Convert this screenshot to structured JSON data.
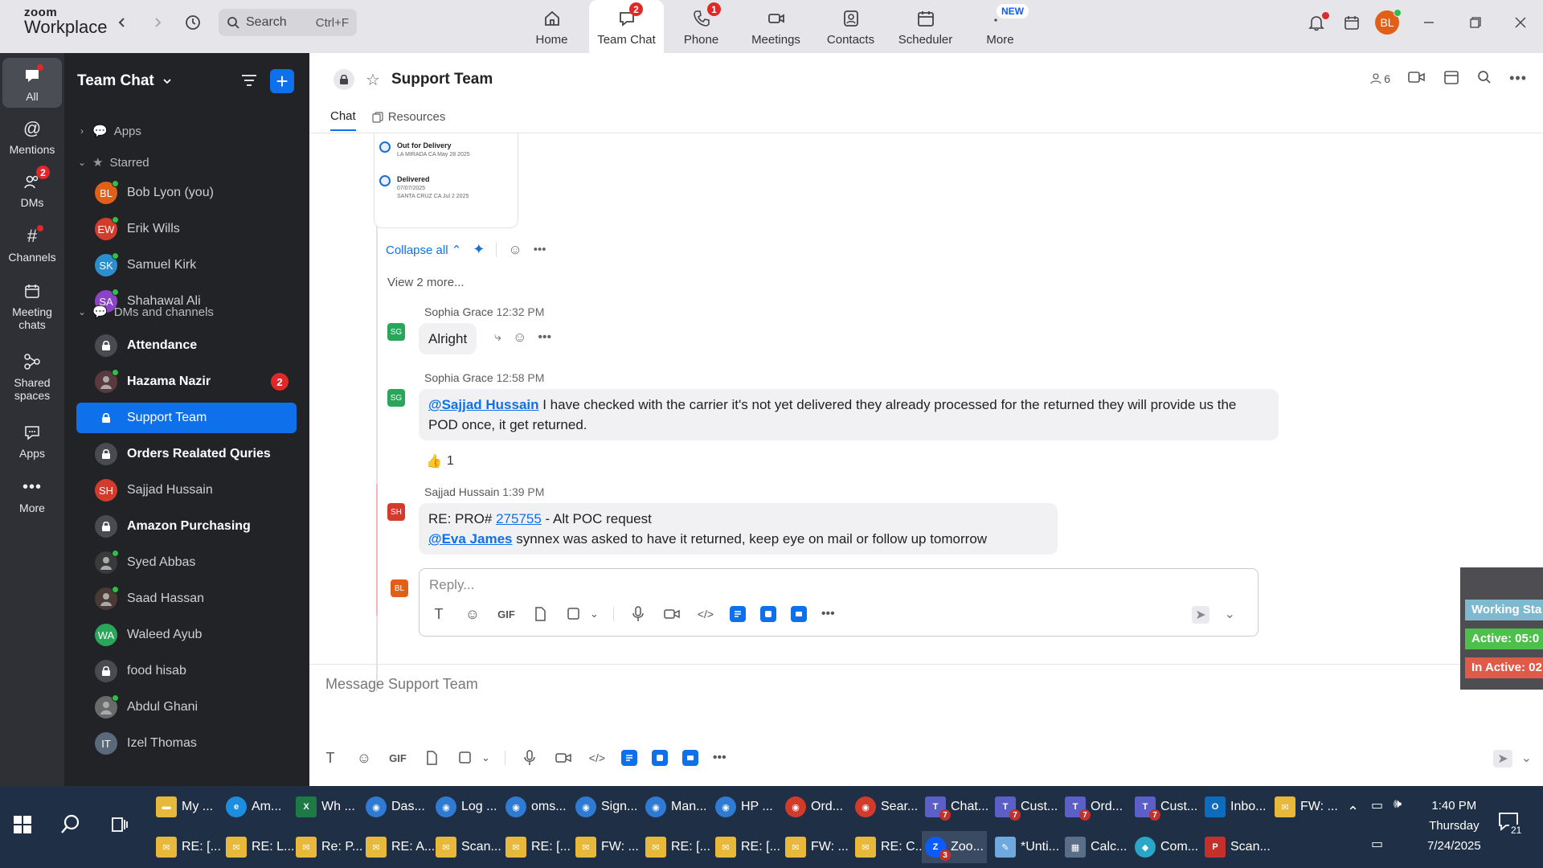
{
  "app": {
    "logo_line1": "zoom",
    "logo_line2": "Workplace"
  },
  "search": {
    "label": "Search",
    "shortcut": "Ctrl+F"
  },
  "top_tabs": [
    {
      "label": "Home",
      "badge": ""
    },
    {
      "label": "Team Chat",
      "badge": "2"
    },
    {
      "label": "Phone",
      "badge": "1"
    },
    {
      "label": "Meetings",
      "badge": ""
    },
    {
      "label": "Contacts",
      "badge": ""
    },
    {
      "label": "Scheduler",
      "badge": ""
    },
    {
      "label": "More",
      "badge": "NEW"
    }
  ],
  "user": {
    "initials": "BL",
    "color": "#e0601a"
  },
  "rail": [
    {
      "label": "All"
    },
    {
      "label": "Mentions"
    },
    {
      "label": "DMs",
      "badge": "2"
    },
    {
      "label": "Channels"
    },
    {
      "label": "Meeting chats"
    },
    {
      "label": "Shared spaces"
    },
    {
      "label": "Apps"
    },
    {
      "label": "More"
    }
  ],
  "sidebar": {
    "title": "Team Chat",
    "sections": {
      "apps": "Apps",
      "starred": "Starred",
      "dms": "DMs and channels"
    },
    "starred": [
      {
        "initials": "BL",
        "name": "Bob Lyon (you)",
        "color": "#e0601a"
      },
      {
        "initials": "EW",
        "name": "Erik Wills",
        "color": "#d33b2c"
      },
      {
        "initials": "SK",
        "name": "Samuel Kirk",
        "color": "#2b8fcf"
      },
      {
        "initials": "SA",
        "name": "Shahawal Ali",
        "color": "#8b44c6"
      }
    ],
    "channels": [
      {
        "type": "lock",
        "name": "Attendance",
        "bold": true
      },
      {
        "type": "photo",
        "name": "Hazama Nazir",
        "bold": true,
        "badge": "2",
        "color": "#5a3a3e"
      },
      {
        "type": "lock",
        "name": "Support Team",
        "selected": true
      },
      {
        "type": "lock",
        "name": "Orders Realated Quries",
        "bold": true
      },
      {
        "type": "initials",
        "initials": "SH",
        "name": "Sajjad Hussain",
        "color": "#d33b2c"
      },
      {
        "type": "lock",
        "name": "Amazon Purchasing",
        "bold": true
      },
      {
        "type": "photo",
        "name": "Syed Abbas",
        "color": "#3a3a3a"
      },
      {
        "type": "photo",
        "name": "Saad Hassan",
        "color": "#4a3a36"
      },
      {
        "type": "initials",
        "initials": "WA",
        "name": "Waleed Ayub",
        "color": "#2aa65a"
      },
      {
        "type": "lock",
        "name": "food hisab"
      },
      {
        "type": "photo",
        "name": "Abdul Ghani",
        "color": "#6a6a6a"
      },
      {
        "type": "initials",
        "initials": "IT",
        "name": "Izel Thomas",
        "color": "#5a6a7a"
      }
    ]
  },
  "channel": {
    "title": "Support Team",
    "member_count": "6",
    "tabs": {
      "chat": "Chat",
      "resources": "Resources"
    }
  },
  "tracking_card": {
    "step1_title": "Out for Delivery",
    "step1_sub": "LA MIRADA CA May 28 2025",
    "step2_title": "Delivered",
    "step2_date": "07/07/2025",
    "step2_sub": "SANTA CRUZ CA Jul 2 2025"
  },
  "thread": {
    "collapse_label": "Collapse all",
    "view_more": "View 2 more...",
    "messages": [
      {
        "initials": "SG",
        "color": "#2aa65a",
        "name": "Sophia Grace",
        "time": "12:32 PM",
        "text": "Alright"
      },
      {
        "initials": "SG",
        "color": "#2aa65a",
        "name": "Sophia Grace",
        "time": "12:58 PM",
        "mention": "@Sajjad Hussain",
        "text": " I have checked with the carrier it's not yet delivered they already processed for the returned they will provide us the POD once, it get returned.",
        "reaction_emoji": "👍",
        "reaction_count": "1"
      },
      {
        "initials": "SH",
        "color": "#d33b2c",
        "name": "Sajjad Hussain",
        "time": "1:39 PM",
        "line1_prefix": "RE: PRO# ",
        "line1_link": "275755",
        "line1_suffix": " - Alt POC request",
        "line2_mention": "@Eva James",
        "line2_text": " synnex was asked to have it returned, keep eye on mail or follow up tomorrow"
      }
    ],
    "reply_placeholder": "Reply..."
  },
  "composer": {
    "placeholder": "Message Support Team",
    "gif_label": "GIF"
  },
  "working_status": {
    "status": "Working Sta",
    "active": "Active: 05:0",
    "inactive": "In Active: 02",
    "colors": {
      "status": "#7fb8cf",
      "active": "#4cc04a",
      "inactive": "#e05a4a"
    }
  },
  "taskbar": {
    "row1": [
      {
        "icon": "folder",
        "label": "My ...",
        "color": "#e8b83a"
      },
      {
        "icon": "edge",
        "label": "Am...",
        "color": "#1b8ee0"
      },
      {
        "icon": "excel",
        "label": "Wh ...",
        "color": "#1d7a45"
      },
      {
        "icon": "chrome",
        "label": "Das...",
        "color": "#2f7ad3"
      },
      {
        "icon": "chrome",
        "label": "Log ...",
        "color": "#2f7ad3"
      },
      {
        "icon": "chrome",
        "label": "oms...",
        "color": "#2f7ad3"
      },
      {
        "icon": "chrome",
        "label": "Sign...",
        "color": "#2f7ad3"
      },
      {
        "icon": "chrome",
        "label": "Man...",
        "color": "#2f7ad3"
      },
      {
        "icon": "chrome",
        "label": "HP ...",
        "color": "#2f7ad3"
      },
      {
        "icon": "chrome",
        "label": "Ord...",
        "color": "#d23a2b"
      },
      {
        "icon": "chrome",
        "label": "Sear...",
        "color": "#d23a2b"
      },
      {
        "icon": "teams",
        "label": "Chat...",
        "color": "#5b5fc7",
        "sub": "7"
      },
      {
        "icon": "teams",
        "label": "Cust...",
        "color": "#5b5fc7",
        "sub": "7"
      },
      {
        "icon": "teams",
        "label": "Ord...",
        "color": "#5b5fc7",
        "sub": "7"
      },
      {
        "icon": "teams",
        "label": "Cust...",
        "color": "#5b5fc7",
        "sub": "7"
      },
      {
        "icon": "outlook",
        "label": "Inbo...",
        "color": "#0f6cbd"
      },
      {
        "icon": "mail",
        "label": "FW: ...",
        "color": "#e8b83a"
      }
    ],
    "row2": [
      {
        "icon": "mail",
        "label": "RE: [...",
        "color": "#e8b83a"
      },
      {
        "icon": "mail",
        "label": "RE: L...",
        "color": "#e8b83a"
      },
      {
        "icon": "mail",
        "label": "Re: P...",
        "color": "#e8b83a"
      },
      {
        "icon": "mail",
        "label": "RE: A...",
        "color": "#e8b83a"
      },
      {
        "icon": "mail",
        "label": "Scan...",
        "color": "#e8b83a"
      },
      {
        "icon": "mail",
        "label": "RE: [...",
        "color": "#e8b83a"
      },
      {
        "icon": "mail",
        "label": "FW: ...",
        "color": "#e8b83a"
      },
      {
        "icon": "mail",
        "label": "RE: [...",
        "color": "#e8b83a"
      },
      {
        "icon": "mail",
        "label": "RE: [...",
        "color": "#e8b83a"
      },
      {
        "icon": "mail",
        "label": "FW: ...",
        "color": "#e8b83a"
      },
      {
        "icon": "mail",
        "label": "RE: C...",
        "color": "#e8b83a"
      },
      {
        "icon": "zoom",
        "label": "Zoo...",
        "color": "#0b5cff",
        "sub": "3",
        "active": true
      },
      {
        "icon": "notepad",
        "label": "*Unti...",
        "color": "#6fa8dc"
      },
      {
        "icon": "calc",
        "label": "Calc...",
        "color": "#5a6e88"
      },
      {
        "icon": "app",
        "label": "Com...",
        "color": "#2aa6c8"
      },
      {
        "icon": "pdf",
        "label": "Scan...",
        "color": "#c4312b"
      }
    ],
    "time": "1:40 PM",
    "day": "Thursday",
    "date": "7/24/2025",
    "notification_count": "21"
  }
}
